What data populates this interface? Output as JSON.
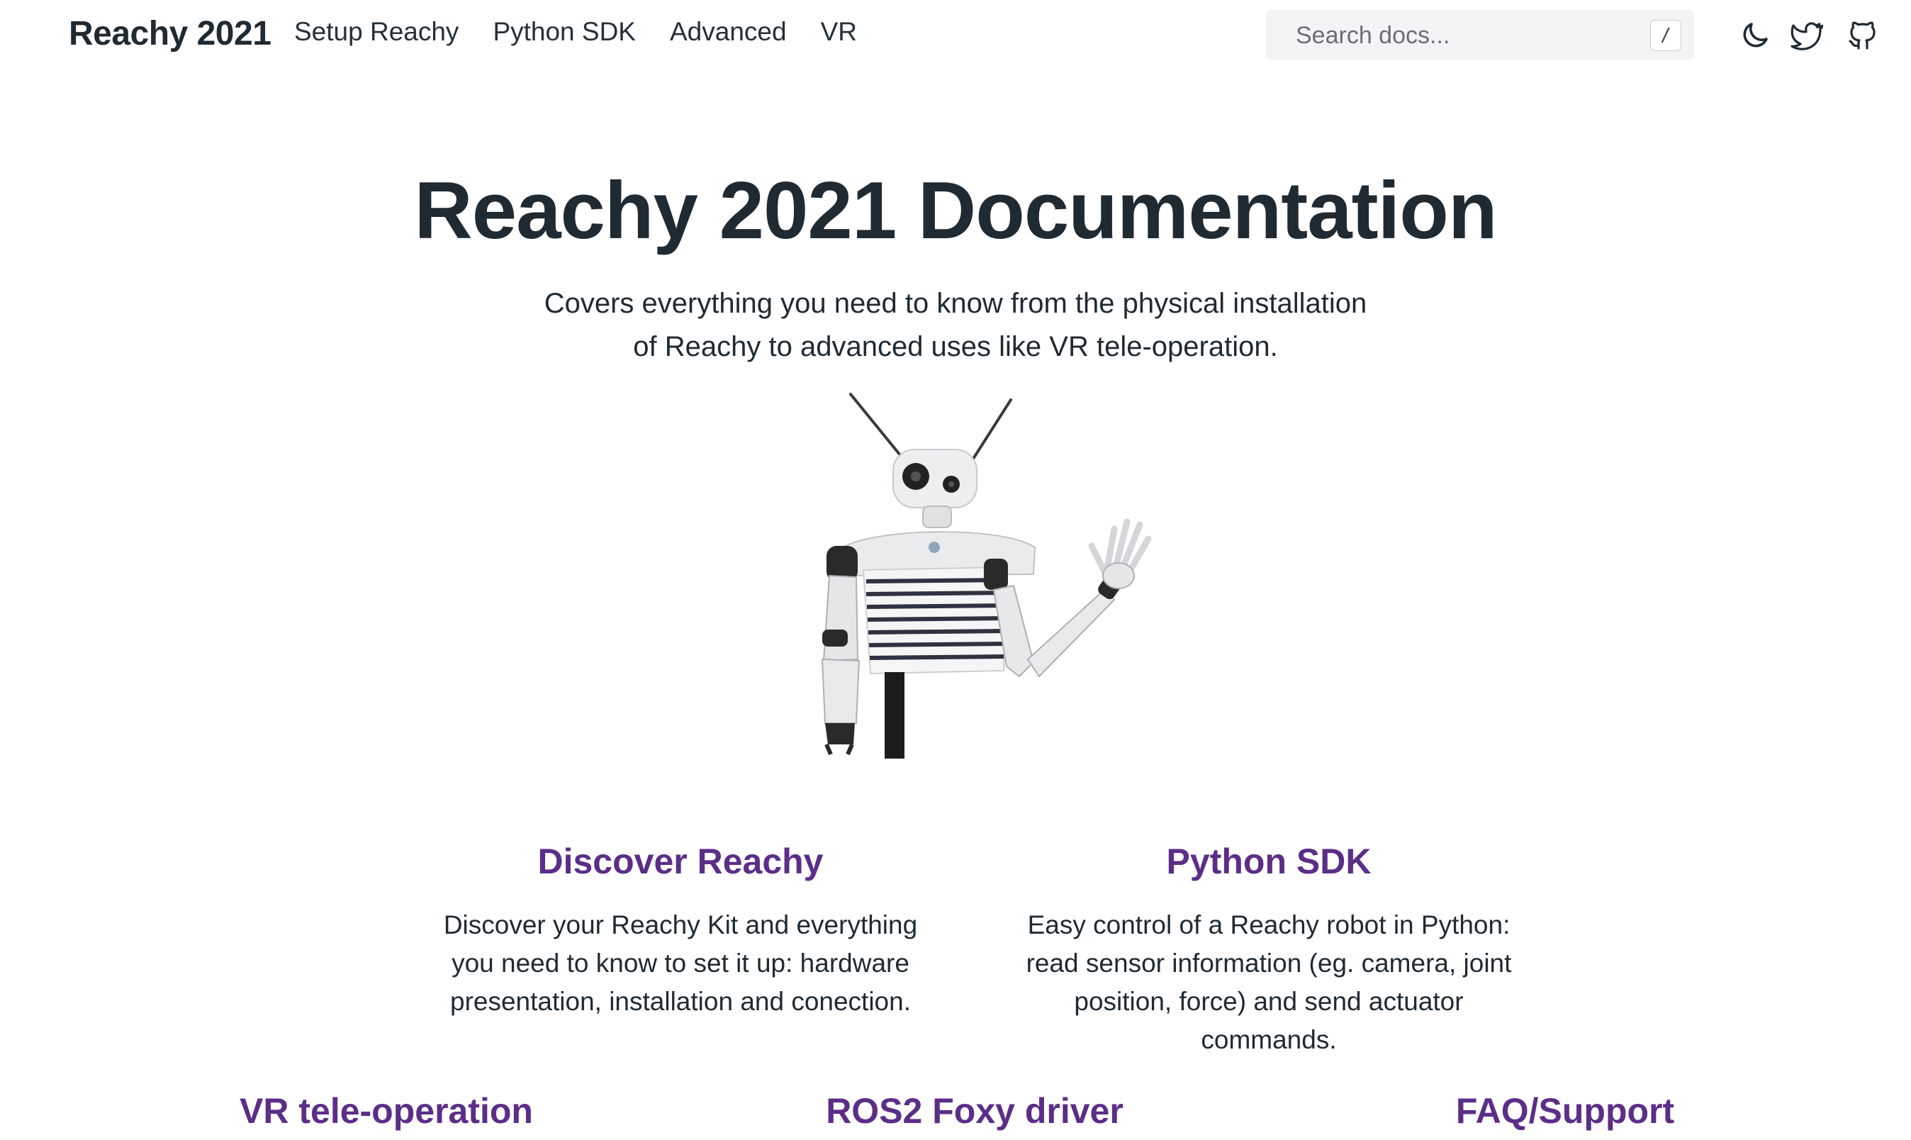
{
  "header": {
    "brand": "Reachy 2021",
    "nav": [
      "Setup Reachy",
      "Python SDK",
      "Advanced",
      "VR"
    ],
    "search": {
      "placeholder": "Search docs...",
      "shortcut": "/"
    },
    "icons": [
      "moon-icon",
      "twitter-icon",
      "github-icon"
    ]
  },
  "hero": {
    "title": "Reachy 2021 Documentation",
    "description": "Covers everything you need to know from the physical installation of Reachy to advanced uses like VR tele-operation."
  },
  "cards": [
    {
      "title": "Discover Reachy",
      "description": "Discover your Reachy Kit and everything you need to know to set it up: hardware presentation, installation and conection."
    },
    {
      "title": "Python SDK",
      "description": "Easy control of a Reachy robot in Python: read sensor information (eg. camera, joint position, force) and send actuator commands."
    },
    {
      "title": "VR tele-operation"
    },
    {
      "title": "ROS2 Foxy driver"
    },
    {
      "title": "FAQ/Support"
    }
  ],
  "colors": {
    "accent": "#5b2e88",
    "text": "#1f2a33",
    "search_bg": "#f3f4f5"
  }
}
